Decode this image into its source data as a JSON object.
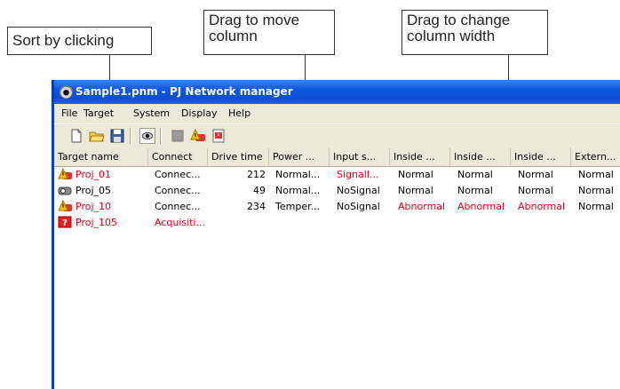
{
  "callouts": {
    "sort": "Sort by clicking",
    "move": [
      "Drag to move",
      "column"
    ],
    "width": [
      "Drag to change",
      "column width"
    ]
  },
  "window": {
    "title": "Sample1.pnm - PJ Network manager",
    "menu": [
      "File",
      "Target",
      "System",
      "Display",
      "Help"
    ],
    "toolbar_icons": [
      "new-file-icon",
      "open-folder-icon",
      "save-icon",
      "monitor-eye-icon",
      "gray-square-icon",
      "warning-projector-icon",
      "alert-list-icon"
    ]
  },
  "columns": [
    "Target name",
    "Connect",
    "Drive time",
    "Power ...",
    "Input s...",
    "Inside ...",
    "Inside ...",
    "Inside ...",
    "Extern..."
  ],
  "rows": [
    {
      "icon": "warning-projector-icon",
      "name": "Proj_01",
      "connect": "Connec...",
      "drive": "212",
      "power": "Normal...",
      "input": "SignalI...",
      "in1": "Normal",
      "in2": "Normal",
      "in3": "Normal",
      "ext": "Normal",
      "colors": {
        "name": "red",
        "connect": "blk",
        "drive": "blk",
        "power": "blk",
        "input": "red",
        "in1": "blk",
        "in2": "blk",
        "in3": "blk",
        "ext": "blk"
      }
    },
    {
      "icon": "projector-icon",
      "name": "Proj_05",
      "connect": "Connec...",
      "drive": "49",
      "power": "Normal...",
      "input": "NoSignal",
      "in1": "Normal",
      "in2": "Normal",
      "in3": "Normal",
      "ext": "Normal",
      "colors": {
        "name": "blk",
        "connect": "blk",
        "drive": "blk",
        "power": "blk",
        "input": "blk",
        "in1": "blk",
        "in2": "blk",
        "in3": "blk",
        "ext": "blk"
      }
    },
    {
      "icon": "warning-projector-icon",
      "name": "Proj_10",
      "connect": "Connec...",
      "drive": "234",
      "power": "Temper...",
      "input": "NoSignal",
      "in1": "Abnormal",
      "in2": "Abnormal",
      "in3": "Abnormal",
      "ext": "Normal",
      "colors": {
        "name": "red",
        "connect": "blk",
        "drive": "blk",
        "power": "blk",
        "input": "blk",
        "in1": "red",
        "in2": "red",
        "in3": "red",
        "ext": "blk"
      }
    },
    {
      "icon": "error-projector-icon",
      "name": "Proj_105",
      "connect": "Acquisiti...",
      "drive": "",
      "power": "",
      "input": "",
      "in1": "",
      "in2": "",
      "in3": "",
      "ext": "",
      "colors": {
        "name": "red",
        "connect": "red",
        "drive": "blk",
        "power": "blk",
        "input": "blk",
        "in1": "blk",
        "in2": "blk",
        "in3": "blk",
        "ext": "blk"
      }
    }
  ],
  "colors": {
    "title_blue": "#0a58e0",
    "alert_red": "#e0001a",
    "chrome": "#ece9d8"
  }
}
